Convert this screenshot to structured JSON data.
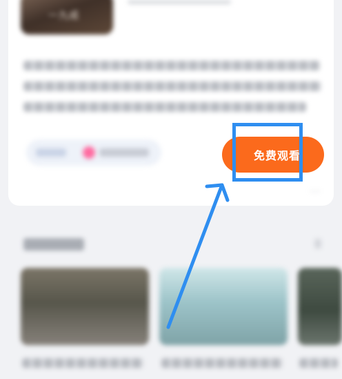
{
  "card": {
    "thumbnail_text": "一九成",
    "watch_button_label": "免费观看",
    "more_label": "···"
  },
  "colors": {
    "accent_orange": "#fb6a1c",
    "annotation_blue": "#2f8ef0",
    "background": "#f1f2f5"
  },
  "icons": {
    "tag": "heart-icon",
    "more": "more-icon",
    "pointer": "arrow-icon"
  }
}
